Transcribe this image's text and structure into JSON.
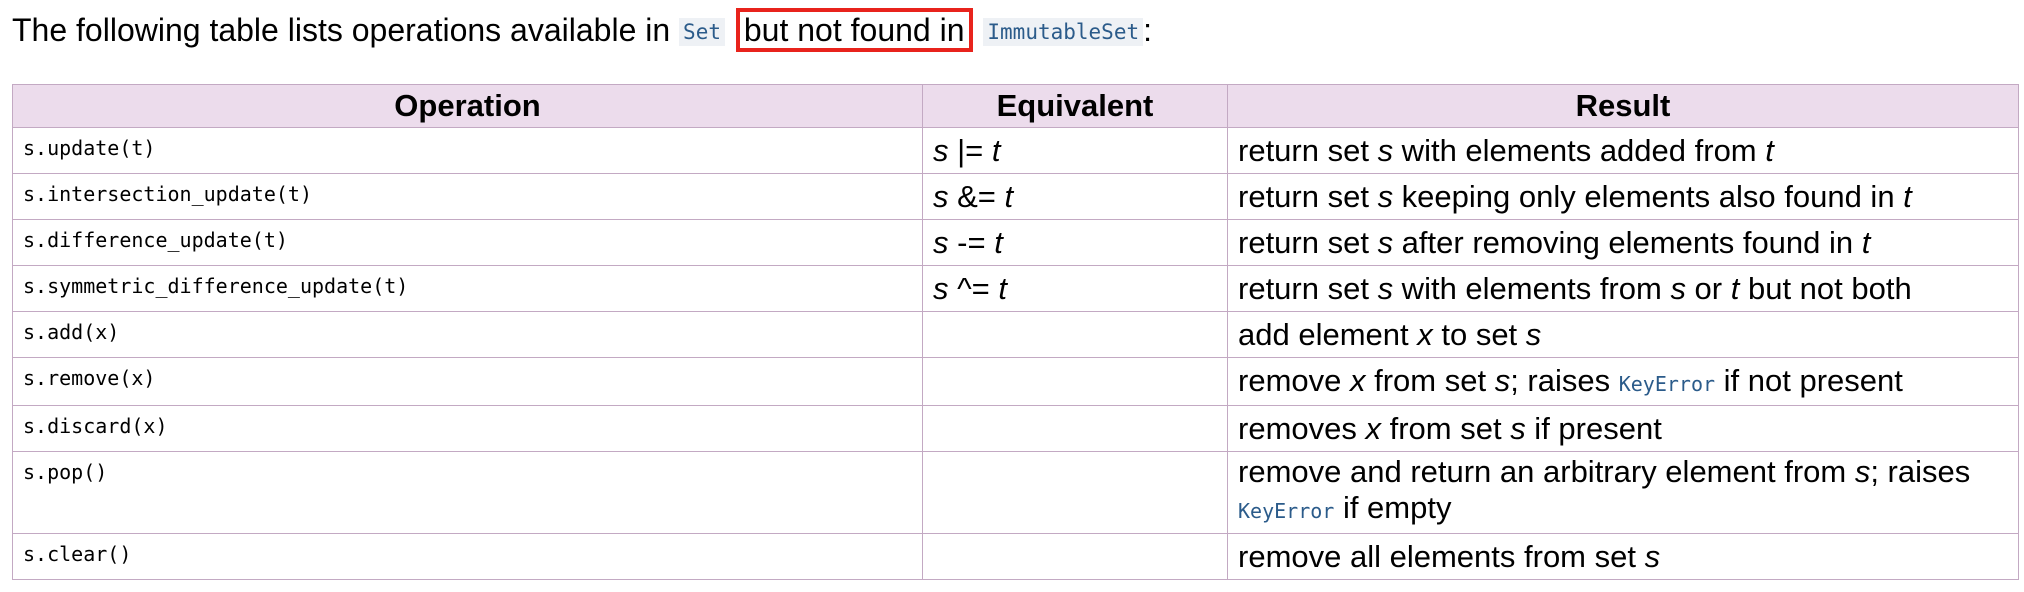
{
  "intro": {
    "text_before": "The following table lists operations available in",
    "code_set": "Set",
    "highlighted": "but not found in",
    "code_immutable": "ImmutableSet",
    "text_after": ":"
  },
  "table": {
    "headers": [
      "Operation",
      "Equivalent",
      "Result"
    ],
    "rows": [
      {
        "op": "s.update(t)",
        "eq": {
          "v1": "s",
          "sym": "|=",
          "v2": "t"
        },
        "res": {
          "p1": "return set ",
          "v1": "s",
          "p2": " with elements added from ",
          "v2": "t"
        }
      },
      {
        "op": "s.intersection_update(t)",
        "eq": {
          "v1": "s",
          "sym": "&=",
          "v2": "t"
        },
        "res": {
          "p1": "return set ",
          "v1": "s",
          "p2": " keeping only elements also found in ",
          "v2": "t"
        }
      },
      {
        "op": "s.difference_update(t)",
        "eq": {
          "v1": "s",
          "sym": "-=",
          "v2": "t"
        },
        "res": {
          "p1": "return set ",
          "v1": "s",
          "p2": " after removing elements found in ",
          "v2": "t"
        }
      },
      {
        "op": "s.symmetric_difference_update(t)",
        "eq": {
          "v1": "s",
          "sym": "^=",
          "v2": "t"
        },
        "res": {
          "p1": "return set ",
          "v1": "s",
          "p2": " with elements from ",
          "v2": "s",
          "p3": " or ",
          "v3": "t",
          "p4": " but not both"
        }
      },
      {
        "op": "s.add(x)",
        "res": {
          "p1": "add element ",
          "v1": "x",
          "p2": " to set ",
          "v2": "s"
        }
      },
      {
        "op": "s.remove(x)",
        "res": {
          "p1": "remove ",
          "v1": "x",
          "p2": " from set ",
          "v2": "s",
          "p3": "; raises ",
          "code": "KeyError",
          "p4": " if not present"
        }
      },
      {
        "op": "s.discard(x)",
        "res": {
          "p1": "removes ",
          "v1": "x",
          "p2": " from set ",
          "v2": "s",
          "p3": " if present"
        }
      },
      {
        "op": "s.pop()",
        "res": {
          "p1": "remove and return an arbitrary element from ",
          "v1": "s",
          "p2": "; raises",
          "code": "KeyError",
          "p3": " if empty"
        }
      },
      {
        "op": "s.clear()",
        "res": {
          "p1": "remove all elements from set ",
          "v1": "s"
        }
      }
    ]
  },
  "colors": {
    "header_bg": "#ecdcec",
    "border": "#c3a9c3",
    "highlight_box": "#e8231c",
    "code_text": "#2b5b8a"
  }
}
